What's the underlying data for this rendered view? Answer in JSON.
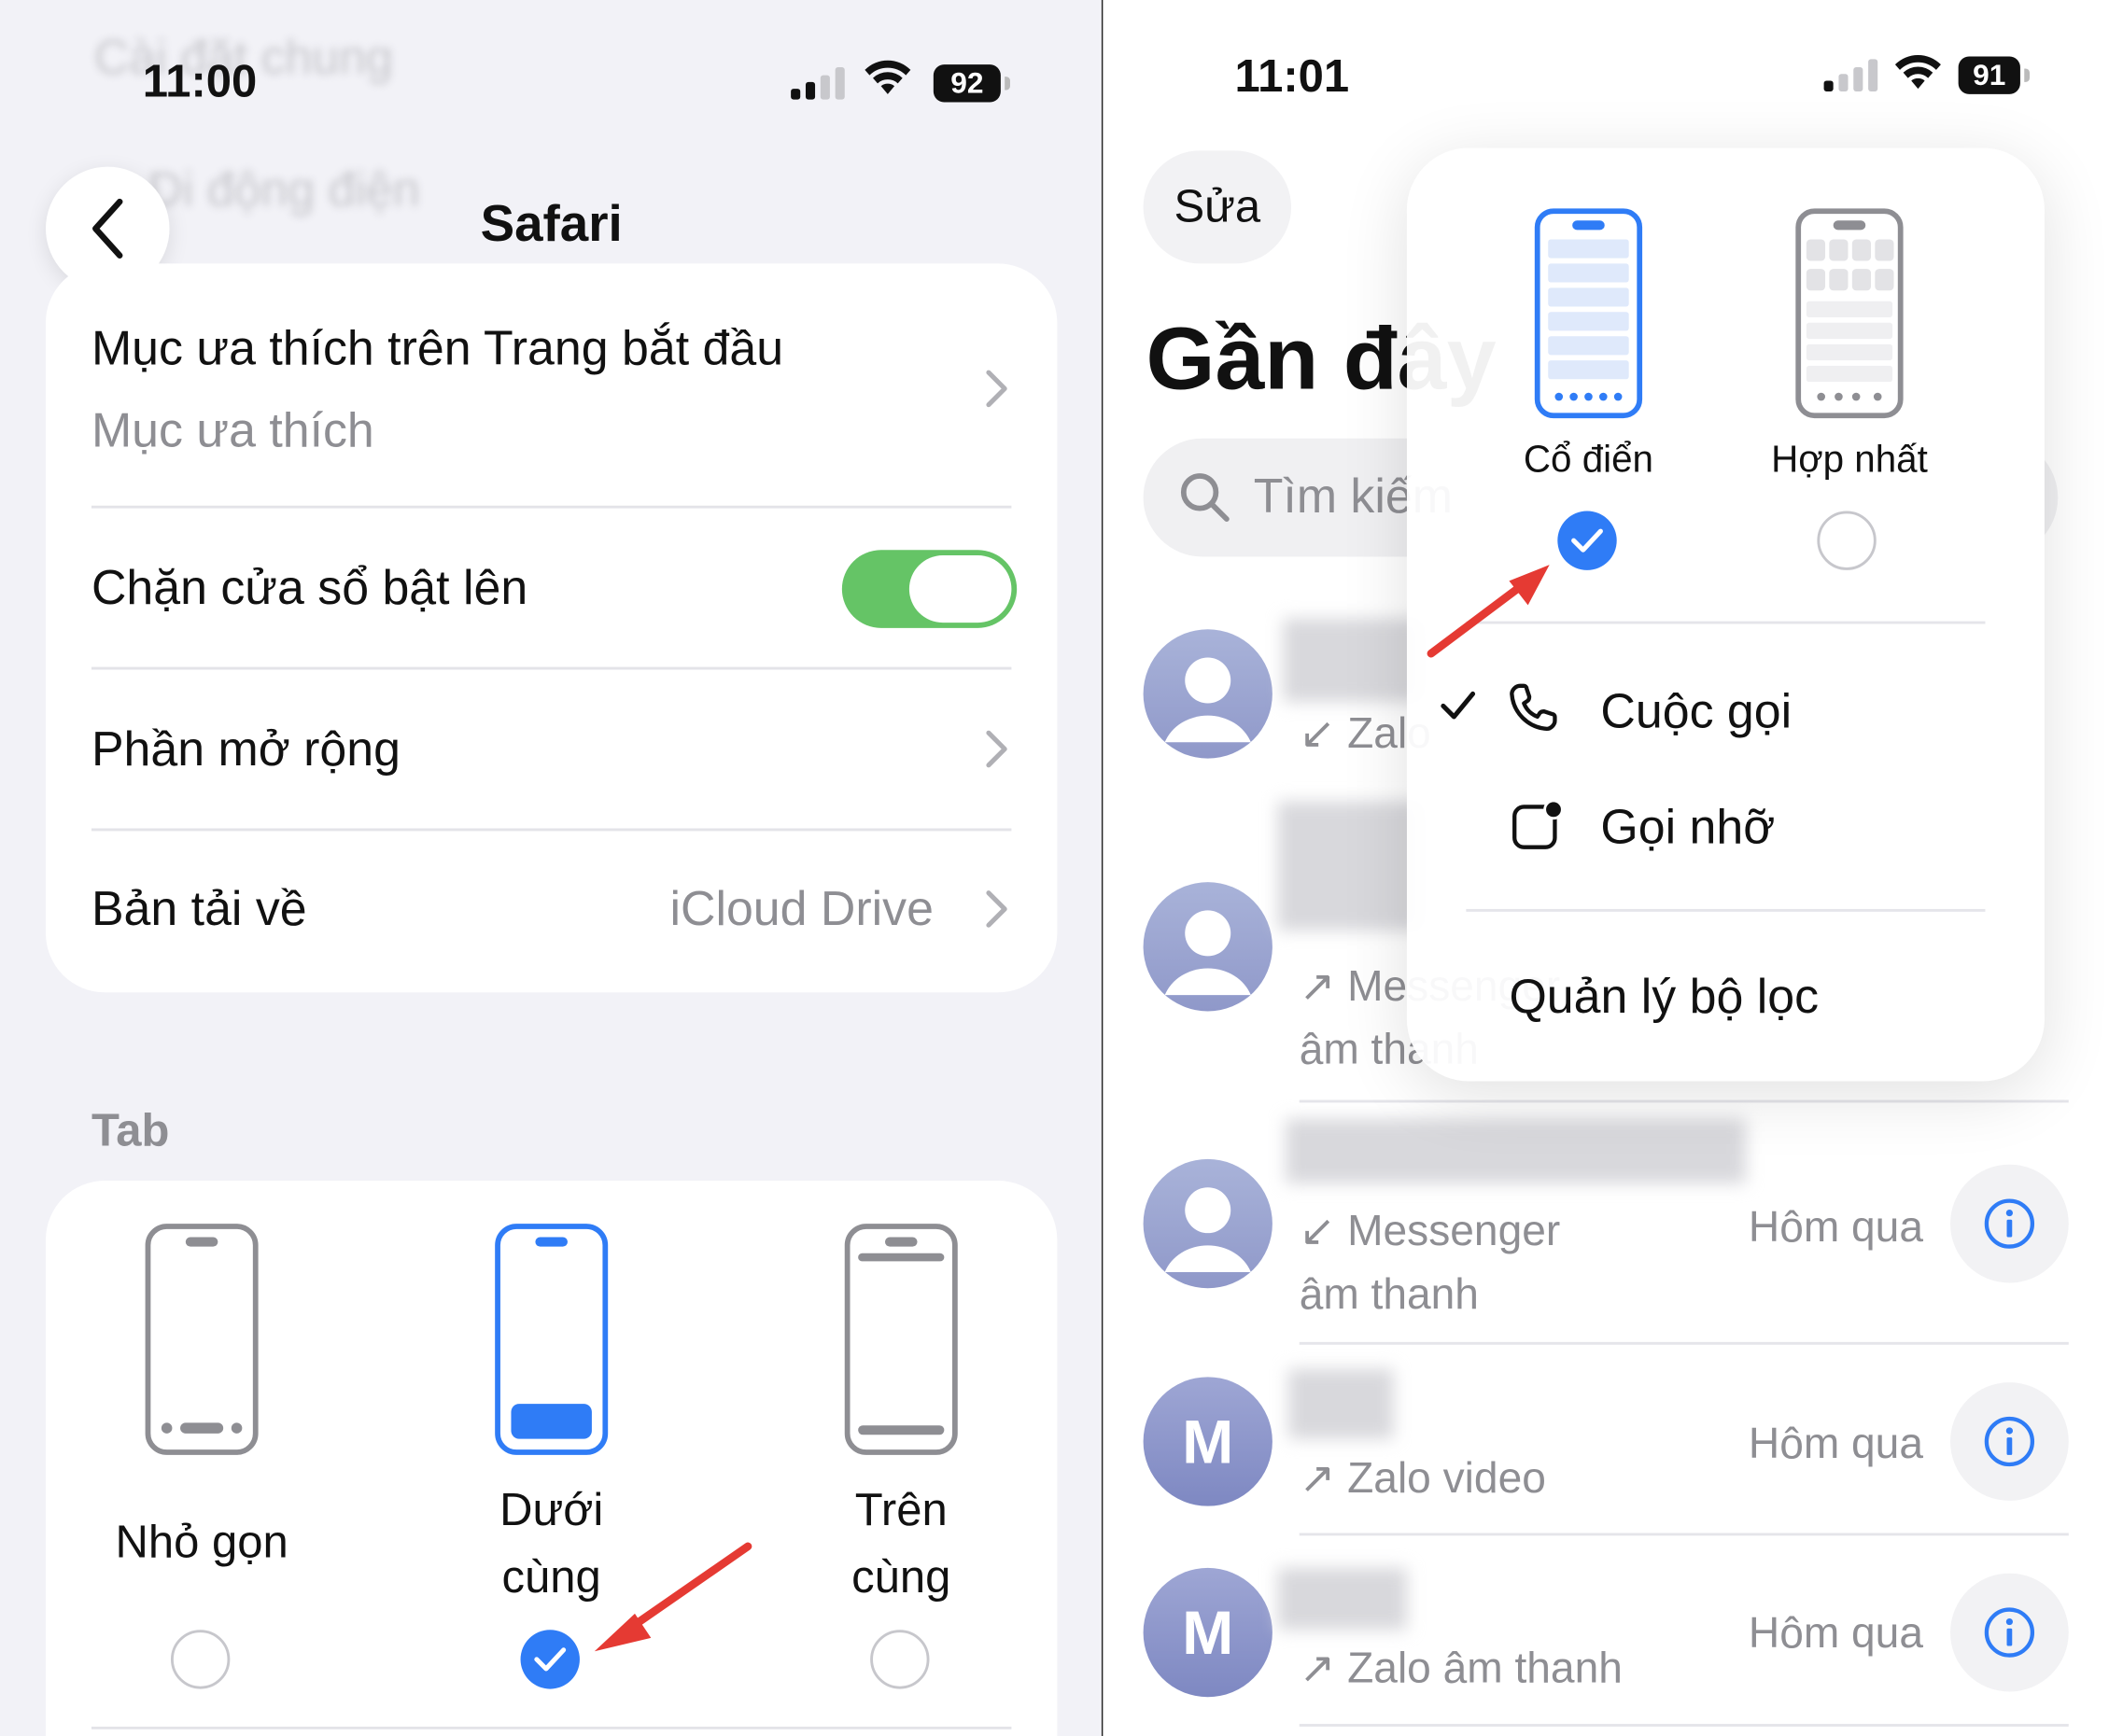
{
  "left_screen": {
    "status": {
      "time": "11:00",
      "battery": "92"
    },
    "background_text": {
      "line1": "Cài đặt chung",
      "line2": "Di động điện"
    },
    "nav": {
      "title": "Safari"
    },
    "settings": {
      "favorites": {
        "label": "Mục ưa thích trên Trang bắt đầu",
        "value": "Mục ưa thích"
      },
      "block_popups": {
        "label": "Chặn cửa sổ bật lên",
        "enabled": true
      },
      "extensions": {
        "label": "Phần mở rộng"
      },
      "downloads": {
        "label": "Bản tải về",
        "value": "iCloud Drive"
      }
    },
    "tab_section": {
      "header": "Tab",
      "options": [
        {
          "label": "Nhỏ gọn",
          "selected": false
        },
        {
          "label_line1": "Dưới",
          "label_line2": "cùng",
          "selected": true
        },
        {
          "label_line1": "Trên",
          "label_line2": "cùng",
          "selected": false
        }
      ]
    }
  },
  "right_screen": {
    "status": {
      "time": "11:01",
      "battery": "91"
    },
    "edit_label": "Sửa",
    "title": "Gần đây",
    "search_placeholder": "Tìm kiếm",
    "layout_menu": {
      "options": [
        {
          "label": "Cổ điển",
          "selected": true
        },
        {
          "label": "Hợp nhất",
          "selected": false
        }
      ],
      "items": [
        {
          "label": "Cuộc gọi",
          "checked": true,
          "icon": "phone-icon"
        },
        {
          "label": "Gọi nhỡ",
          "checked": false,
          "icon": "missed-call-icon"
        },
        {
          "label": "Quản lý bộ lọc",
          "checked": false
        }
      ]
    },
    "calls": [
      {
        "avatar": "person",
        "type": "↙ Zalo",
        "time": ""
      },
      {
        "avatar": "person",
        "type": "↗ Messenger",
        "type2": "âm thanh",
        "time": ""
      },
      {
        "avatar": "person",
        "type": "↙ Messenger",
        "type2": "âm thanh",
        "time": "Hôm qua"
      },
      {
        "avatar": "M",
        "type": "↗ Zalo video",
        "time": "Hôm qua"
      },
      {
        "avatar": "M",
        "type": "↗ Zalo âm thanh",
        "time": "Hôm qua"
      }
    ]
  },
  "colors": {
    "accent": "#2f7cf6",
    "toggle_on": "#65c466",
    "annotation_arrow": "#e53a33",
    "secondary_text": "#8e8e93"
  }
}
